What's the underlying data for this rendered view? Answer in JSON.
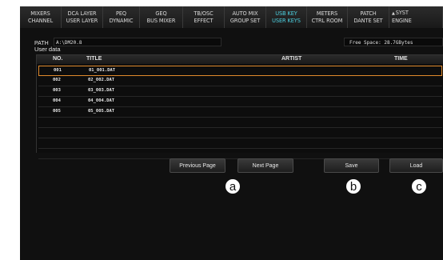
{
  "tabs": [
    {
      "line1": "MIXERS",
      "line2": "CHANNEL",
      "active": false
    },
    {
      "line1": "DCA LAYER",
      "line2": "USER LAYER",
      "active": false
    },
    {
      "line1": "PEQ",
      "line2": "DYNAMIC",
      "active": false
    },
    {
      "line1": "GEQ",
      "line2": "BUS MIXER",
      "active": false
    },
    {
      "line1": "TB/OSC",
      "line2": "EFFECT",
      "active": false
    },
    {
      "line1": "AUTO MIX",
      "line2": "GROUP SET",
      "active": false
    },
    {
      "line1": "USB KEY",
      "line2": "USER KEYS",
      "active": true
    },
    {
      "line1": "METERS",
      "line2": "CTRL ROOM",
      "active": false
    },
    {
      "line1": "PATCH",
      "line2": "DANTE SET",
      "active": false
    },
    {
      "line1": "SYST",
      "line2": "ENGINE",
      "active": false,
      "icon": "user-icon"
    }
  ],
  "path": {
    "label": "PATH",
    "value": "A:\\DM20.8"
  },
  "free_space": "Free Space:  28.7GBytes",
  "user_data_label": "User data",
  "table": {
    "headers": {
      "no": "NO.",
      "title": "TITLE",
      "artist": "ARTIST",
      "time": "TIME"
    },
    "rows": [
      {
        "no": "001",
        "title": "01_001.DAT",
        "artist": "",
        "time": "",
        "selected": true
      },
      {
        "no": "002",
        "title": "02_002.DAT",
        "artist": "",
        "time": "",
        "selected": false
      },
      {
        "no": "003",
        "title": "03_003.DAT",
        "artist": "",
        "time": "",
        "selected": false
      },
      {
        "no": "004",
        "title": "04_004.DAT",
        "artist": "",
        "time": "",
        "selected": false
      },
      {
        "no": "005",
        "title": "05_005.DAT",
        "artist": "",
        "time": "",
        "selected": false
      }
    ]
  },
  "buttons": {
    "previous": "Previous Page",
    "next": "Next Page",
    "save": "Save",
    "load": "Load"
  },
  "callouts": {
    "a": "a",
    "b": "b",
    "c": "c"
  },
  "colors": {
    "active_tab": "#4cd0e0",
    "selection": "#e08a2c"
  }
}
